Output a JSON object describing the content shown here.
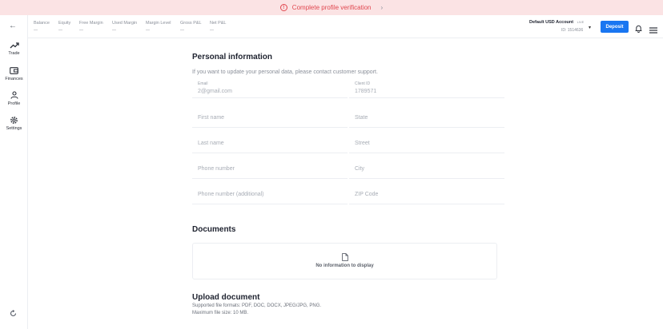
{
  "banner": {
    "text": "Complete profile verification",
    "alert_icon": "alert-circle-icon",
    "chevron": "›"
  },
  "sidebar": {
    "back_icon": "←",
    "items": [
      {
        "label": "Trade",
        "icon": "trending-up-icon"
      },
      {
        "label": "Finances",
        "icon": "wallet-icon"
      },
      {
        "label": "Profile",
        "icon": "person-icon"
      },
      {
        "label": "Settings",
        "icon": "gear-icon"
      }
    ],
    "bottom_icon": "refresh-icon"
  },
  "stats": [
    {
      "label": "Balance",
      "value": "—"
    },
    {
      "label": "Equity",
      "value": "—"
    },
    {
      "label": "Free Margin",
      "value": "—"
    },
    {
      "label": "Used Margin",
      "value": "—"
    },
    {
      "label": "Margin Level",
      "value": "—"
    },
    {
      "label": "Gross P&L",
      "value": "—"
    },
    {
      "label": "Net P&L",
      "value": "—"
    }
  ],
  "account": {
    "name": "Default USD Account",
    "badge": "LIVE",
    "id": "ID: 1514636",
    "caret": "▾"
  },
  "deposit_label": "Deposit",
  "personal": {
    "title": "Personal information",
    "note": "If you want to update your personal data, please contact customer support.",
    "email": {
      "label": "Email",
      "value": "2@gmail.com"
    },
    "client_id": {
      "label": "Client ID",
      "value": "1789571"
    },
    "placeholders": {
      "first_name": "First name",
      "state": "State",
      "last_name": "Last name",
      "street": "Street",
      "phone": "Phone number",
      "city": "City",
      "phone_additional": "Phone number (additional)",
      "zip": "ZIP Code"
    }
  },
  "documents": {
    "title": "Documents",
    "empty_text": "No information to display",
    "icon": "file-icon"
  },
  "upload": {
    "title": "Upload document",
    "formats": "Supported file formats: PDF, DOC, DOCX, JPEG/JPG, PNG.",
    "max_size": "Maximum file size: 10 MB."
  },
  "colors": {
    "accent": "#1976f1",
    "banner_bg": "#fbe3e4",
    "banner_text": "#e0474f"
  }
}
